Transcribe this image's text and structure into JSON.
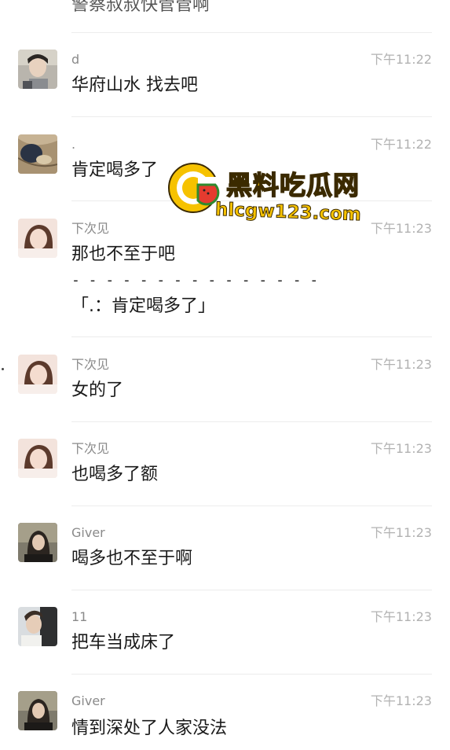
{
  "top_partial_message": "警察叔叔快管管啊",
  "messages": [
    {
      "sender": "d",
      "time": "下午11:22",
      "text": "华府山水 找去吧"
    },
    {
      "sender": ".",
      "time": "下午11:22",
      "text": "肯定喝多了"
    },
    {
      "sender": "下次见",
      "time": "下午11:23",
      "text": "那也不至于吧",
      "quote_separator": "- - - - - - - - - - - - - - -",
      "quote": "「.：肯定喝多了」"
    },
    {
      "sender": "下次见",
      "time": "下午11:23",
      "text": "女的了"
    },
    {
      "sender": "下次见",
      "time": "下午11:23",
      "text": "也喝多了额"
    },
    {
      "sender": "Giver",
      "time": "下午11:23",
      "text": "喝多也不至于啊"
    },
    {
      "sender": "11",
      "time": "下午11:23",
      "text": "把车当成床了"
    },
    {
      "sender": "Giver",
      "time": "下午11:23",
      "text": "情到深处了人家没法"
    }
  ],
  "watermark": {
    "title": "黑料吃瓜网",
    "url": "hlcgw123.com"
  },
  "colors": {
    "background": "#ffffff",
    "sender": "#8a8a8a",
    "time": "#b2b2b2",
    "text": "#1a1a1a",
    "divider": "#ececec",
    "watermark": "#f5c000"
  }
}
